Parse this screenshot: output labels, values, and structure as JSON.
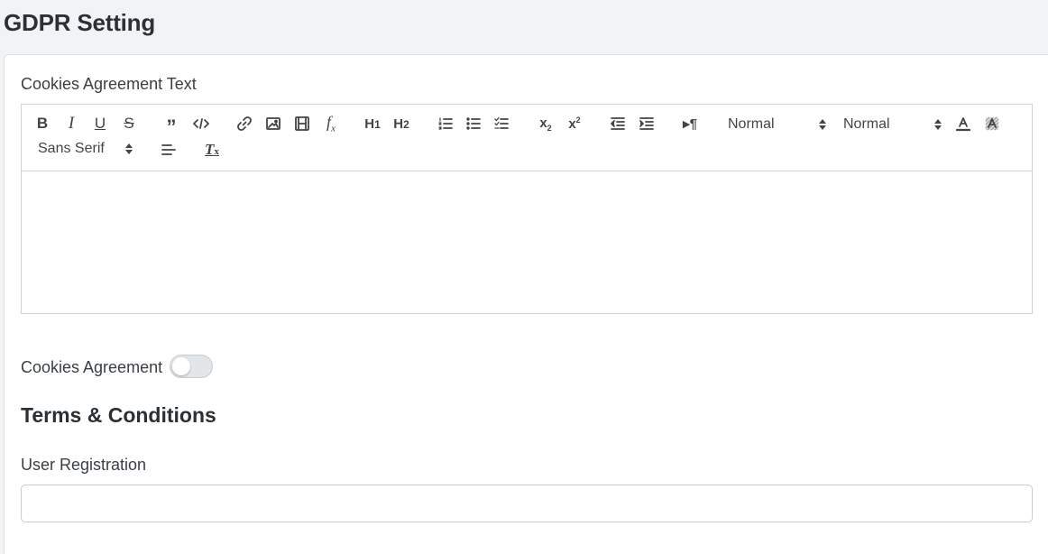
{
  "page": {
    "title": "GDPR Setting"
  },
  "cookies_text": {
    "label": "Cookies Agreement Text",
    "content": ""
  },
  "toolbar": {
    "buttons": [
      {
        "name": "bold-icon",
        "glyph": "B"
      },
      {
        "name": "italic-icon",
        "glyph": "I"
      },
      {
        "name": "underline-icon",
        "glyph": "U"
      },
      {
        "name": "strikethrough-icon",
        "glyph": "S"
      },
      {
        "name": "blockquote-icon"
      },
      {
        "name": "code-block-icon"
      },
      {
        "name": "link-icon"
      },
      {
        "name": "image-icon"
      },
      {
        "name": "video-icon"
      },
      {
        "name": "formula-icon"
      },
      {
        "name": "header-1-icon"
      },
      {
        "name": "header-2-icon"
      },
      {
        "name": "ordered-list-icon"
      },
      {
        "name": "bullet-list-icon"
      },
      {
        "name": "check-list-icon"
      },
      {
        "name": "subscript-icon"
      },
      {
        "name": "superscript-icon"
      },
      {
        "name": "outdent-icon"
      },
      {
        "name": "indent-icon"
      },
      {
        "name": "text-direction-icon"
      },
      {
        "name": "font-color-icon"
      },
      {
        "name": "background-color-icon"
      },
      {
        "name": "align-icon"
      },
      {
        "name": "clear-format-icon"
      }
    ],
    "size_picker": "Normal",
    "header_picker": "Normal",
    "font_picker": "Sans Serif"
  },
  "cookies_agreement": {
    "label": "Cookies Agreement",
    "enabled": false
  },
  "terms": {
    "title": "Terms & Conditions",
    "user_registration": {
      "label": "User Registration",
      "value": "",
      "placeholder": ""
    }
  }
}
